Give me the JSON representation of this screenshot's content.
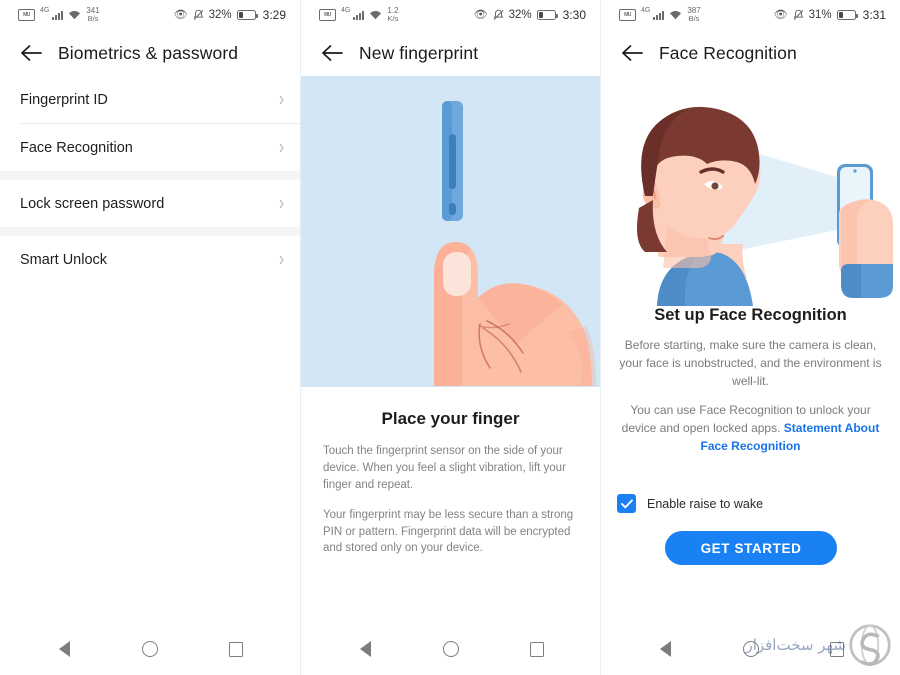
{
  "panels": [
    {
      "status": {
        "vmail_icon": "voicemail-icon",
        "network_type": "4G",
        "wifi_icon": "wifi-icon",
        "data_rate_value": "341",
        "data_rate_unit": "B/s",
        "eye_icon": "eye-comfort-icon",
        "mute_icon": "bell-muted-icon",
        "battery_percent": "32%",
        "clock": "3:29"
      },
      "title": "Biometrics & password",
      "back_icon": "back-arrow-icon",
      "list": [
        {
          "items": [
            {
              "label": "Fingerprint ID",
              "chevron": "chevron-right-icon"
            },
            {
              "label": "Face Recognition",
              "chevron": "chevron-right-icon"
            }
          ]
        },
        {
          "items": [
            {
              "label": "Lock screen password",
              "chevron": "chevron-right-icon"
            }
          ]
        },
        {
          "items": [
            {
              "label": "Smart Unlock",
              "chevron": "chevron-right-icon"
            }
          ]
        }
      ]
    },
    {
      "status": {
        "data_rate_value": "1.2",
        "data_rate_unit": "K/s",
        "battery_percent": "32%",
        "clock": "3:30"
      },
      "title": "New fingerprint",
      "back_icon": "back-arrow-icon",
      "illustration": "finger-on-side-sensor-illustration",
      "heading": "Place your finger",
      "paragraph1": "Touch the fingerprint sensor on the side of your device. When you feel a slight vibration, lift your finger and repeat.",
      "paragraph2": "Your fingerprint may be less secure than a strong PIN or pattern. Fingerprint data will be encrypted and stored only on your device."
    },
    {
      "status": {
        "data_rate_value": "387",
        "data_rate_unit": "B/s",
        "battery_percent": "31%",
        "clock": "3:31"
      },
      "title": "Face Recognition",
      "back_icon": "back-arrow-icon",
      "illustration": "face-scan-illustration",
      "heading": "Set up Face Recognition",
      "paragraph1": "Before starting, make sure the camera is clean, your face is unobstructed, and the environment is well-lit.",
      "paragraph2_pre": "You can use Face Recognition to unlock your device and open locked apps. ",
      "paragraph2_link": "Statement About Face Recognition",
      "checkbox": {
        "label": "Enable raise to wake",
        "checked": true
      },
      "button": "GET STARTED"
    }
  ],
  "navbar": {
    "back": "nav-back-icon",
    "home": "nav-home-icon",
    "recents": "nav-recents-icon"
  },
  "watermark": {
    "text": "شهر سخت‌افزار",
    "logo": "s-logo"
  },
  "colors": {
    "accent_blue": "#1a81f5",
    "link_blue": "#1a73e8",
    "illustration_bg": "#d3e6f5",
    "skin": "#fcbfa5",
    "hair": "#7a3a32",
    "shirt_blue": "#5b9bd5",
    "group_gap": "#f4f5f6"
  }
}
